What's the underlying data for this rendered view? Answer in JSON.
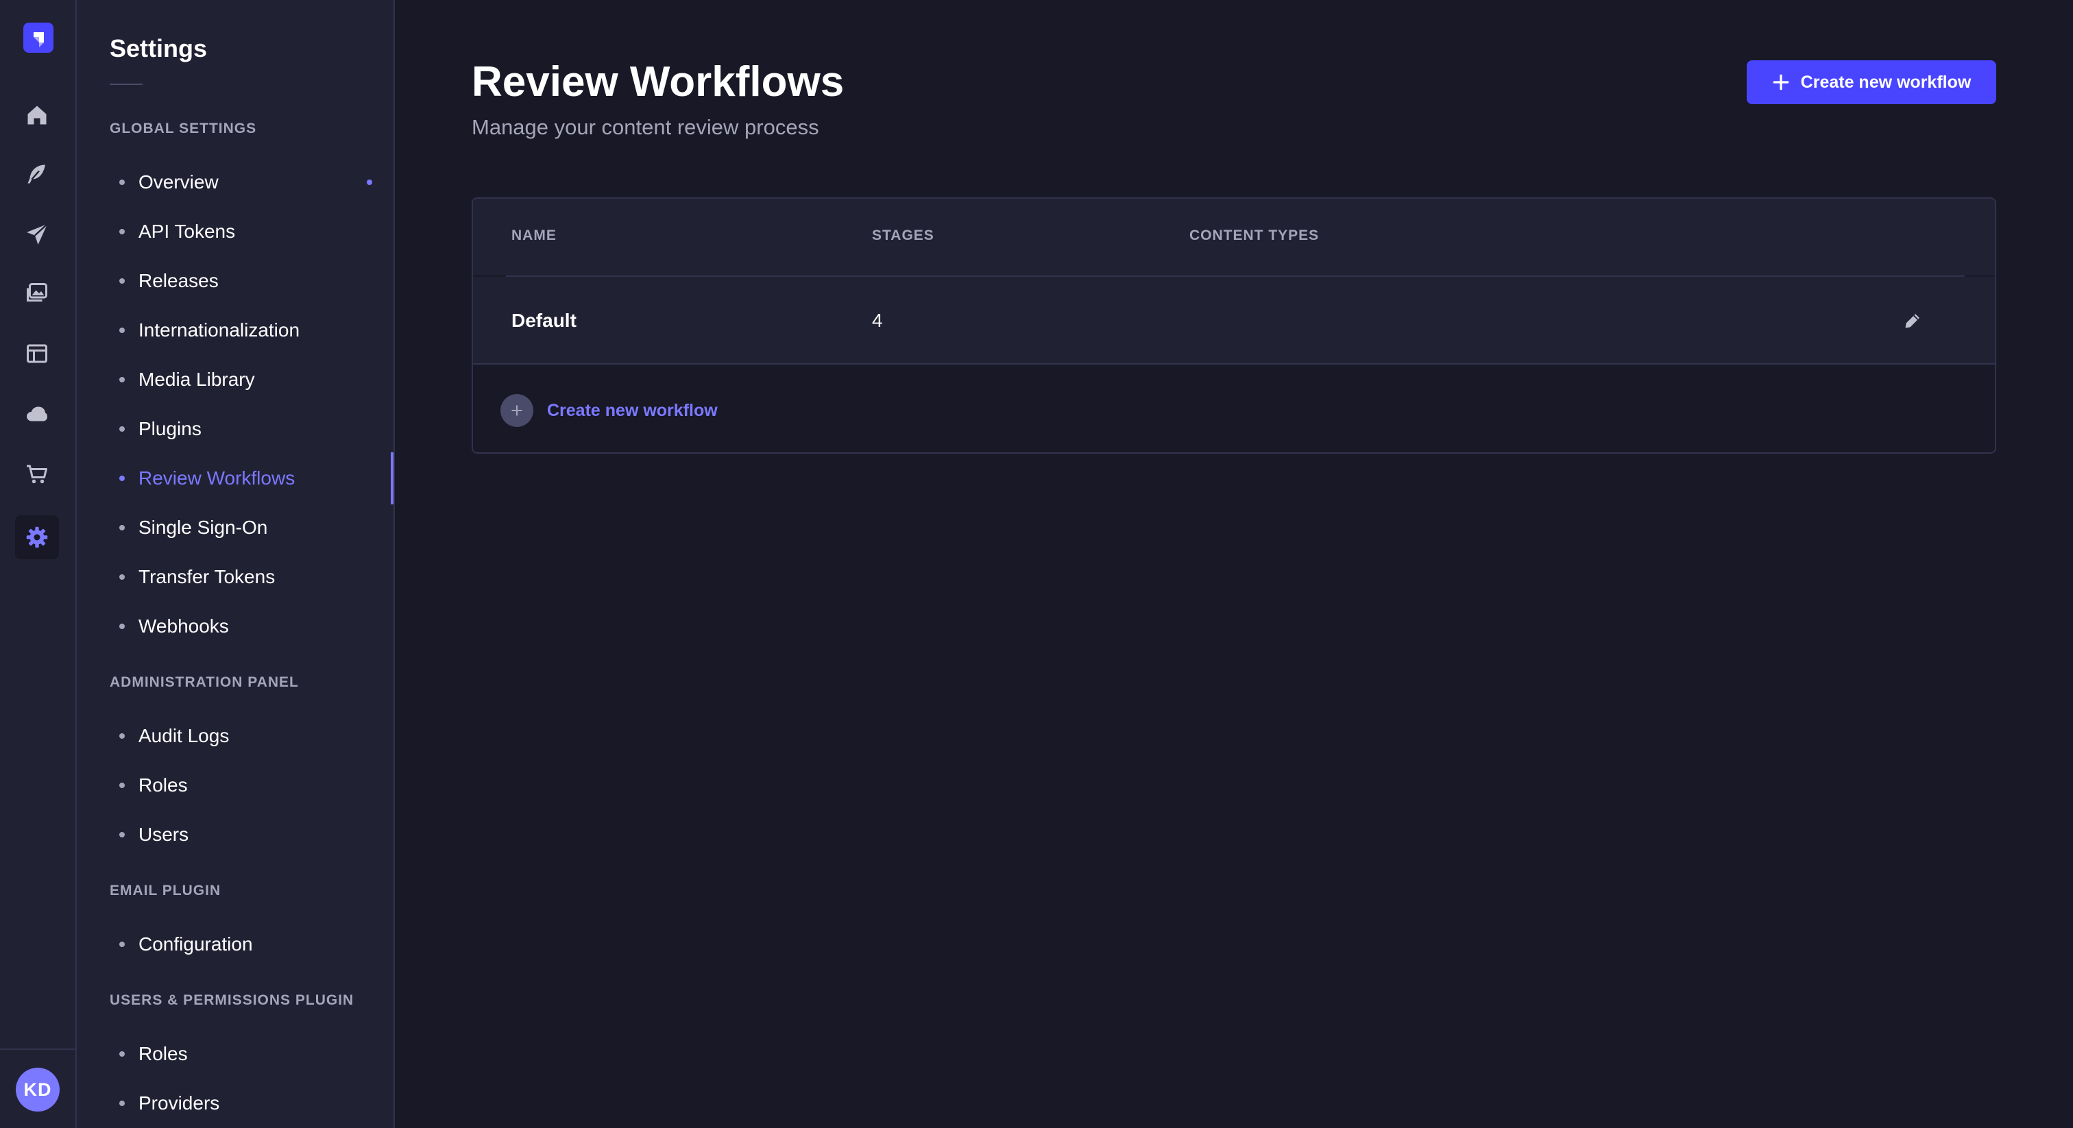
{
  "app": {
    "colors": {
      "accent": "#4945ff",
      "accent_light": "#7b79ff",
      "background": "#181826",
      "surface": "#212134",
      "border": "#32324d",
      "muted": "#a5a5ba"
    }
  },
  "rail": {
    "logo_icon": "strapi-logo-icon",
    "items": [
      {
        "icon": "home-icon",
        "active": false
      },
      {
        "icon": "feather-icon",
        "active": false
      },
      {
        "icon": "paper-plane-icon",
        "active": false
      },
      {
        "icon": "images-icon",
        "active": false
      },
      {
        "icon": "layout-icon",
        "active": false
      },
      {
        "icon": "cloud-icon",
        "active": false
      },
      {
        "icon": "shopping-cart-icon",
        "active": false
      },
      {
        "icon": "gear-icon",
        "active": true
      }
    ],
    "user_initials": "KD"
  },
  "subnav": {
    "title": "Settings",
    "sections": [
      {
        "label": "GLOBAL SETTINGS",
        "items": [
          "Overview",
          "API Tokens",
          "Releases",
          "Internationalization",
          "Media Library",
          "Plugins",
          "Review Workflows",
          "Single Sign-On",
          "Transfer Tokens",
          "Webhooks"
        ]
      },
      {
        "label": "ADMINISTRATION PANEL",
        "items": [
          "Audit Logs",
          "Roles",
          "Users"
        ]
      },
      {
        "label": "EMAIL PLUGIN",
        "items": [
          "Configuration"
        ]
      },
      {
        "label": "USERS & PERMISSIONS PLUGIN",
        "items": [
          "Roles",
          "Providers"
        ]
      }
    ],
    "active_item": "Review Workflows"
  },
  "main": {
    "title": "Review Workflows",
    "subtitle": "Manage your content review process",
    "create_button_label": "Create new workflow",
    "table": {
      "columns": [
        "NAME",
        "STAGES",
        "CONTENT TYPES"
      ],
      "rows": [
        {
          "name": "Default",
          "stages": "4",
          "content_types": ""
        }
      ],
      "add_row_label": "Create new workflow"
    }
  }
}
